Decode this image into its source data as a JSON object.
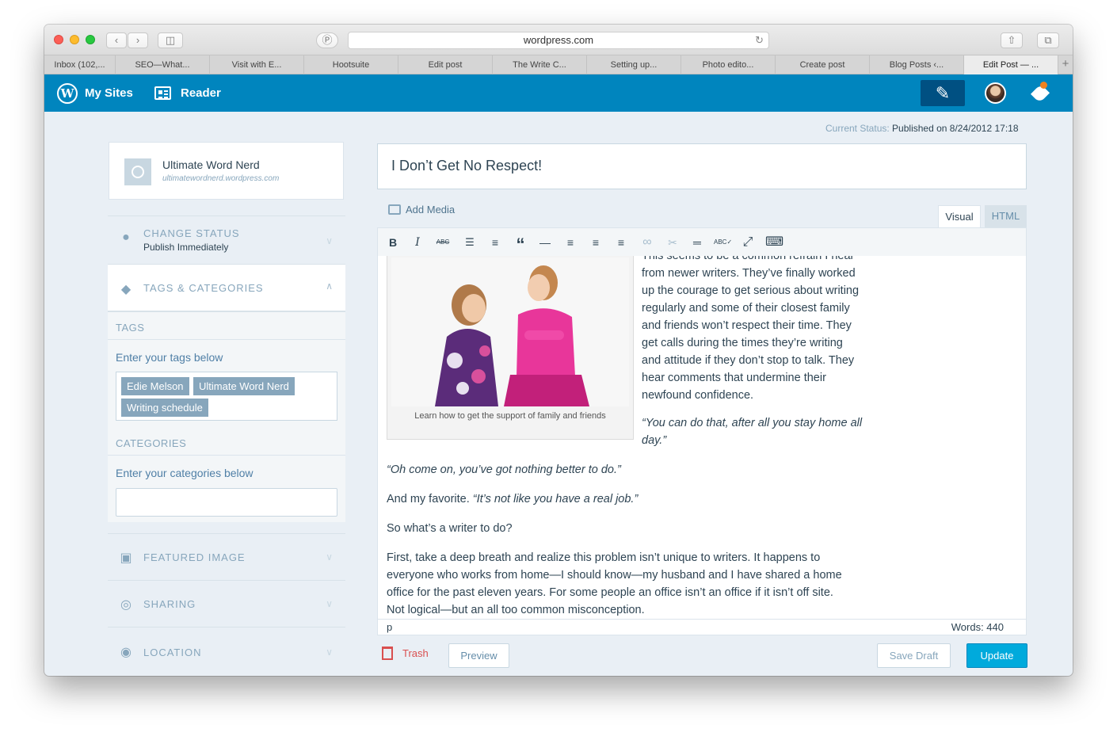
{
  "browser": {
    "url": "wordpress.com",
    "tabs": [
      "Inbox (102,...",
      "SEO—What...",
      "Visit with E...",
      "Hootsuite",
      "Edit post",
      "The Write C...",
      "Setting up...",
      "Photo edito...",
      "Create post",
      "Blog Posts ‹...",
      "Edit Post — ..."
    ],
    "new_tab": "+"
  },
  "masterbar": {
    "my_sites": "My Sites",
    "reader": "Reader",
    "wp_logo_glyph": "W",
    "write_icon": "✎"
  },
  "status": {
    "label": "Current Status:",
    "value": "Published on 8/24/2012 17:18"
  },
  "site": {
    "name": "Ultimate Word Nerd",
    "url": "ultimatewordnerd.wordpress.com"
  },
  "sidebar": {
    "change_status": {
      "title": "CHANGE STATUS",
      "subtitle": "Publish Immediately",
      "icon": "pin-icon"
    },
    "tags_categories": {
      "title": "TAGS & CATEGORIES",
      "icon": "tag-icon"
    },
    "tags_label": "TAGS",
    "tags_hint": "Enter your tags below",
    "tags": [
      "Edie Melson",
      "Ultimate Word Nerd",
      "Writing schedule"
    ],
    "categories_label": "CATEGORIES",
    "categories_hint": "Enter your categories below",
    "featured_image": "FEATURED IMAGE",
    "sharing": "SHARING",
    "location": "LOCATION"
  },
  "editor": {
    "title": "I Don’t Get No Respect!",
    "add_media": "Add Media",
    "tab_visual": "Visual",
    "tab_html": "HTML",
    "toolbar": {
      "bold": "B",
      "italic": "I",
      "strike": "ABC",
      "bullets": "☰",
      "numbers": "≡",
      "quote": "“",
      "hr": "—",
      "align_left": "≡",
      "align_center": "≡",
      "align_right": "≡",
      "link": "∞",
      "unlink": "✂",
      "more": "═",
      "spell": "ABC✓",
      "fullscreen": "⤢",
      "kitchen": "⌨"
    },
    "caption": "Learn how to get the support of family and friends",
    "lines_right": [
      "This seems to be a common refrain I hear",
      "from newer writers. They’ve finally worked",
      "up the courage to get serious about writing",
      "regularly and some of their closest family",
      "and friends won’t respect their time. They",
      "get calls during the times they’re writing",
      "and attitude if they don’t stop to talk. They",
      "hear comments that undermine their",
      "newfound confidence."
    ],
    "quote1_line1": "“You can do that, after all you stay home all",
    "quote1_line2": "day.”",
    "quote2": "“Oh come on, you’ve got nothing better to do.”",
    "favorite_prefix": "And my favorite.",
    "favorite_quote": "“It’s not like you have a real job.”",
    "question": "So what’s a writer to do?",
    "para_lines": [
      "First, take a deep breath and realize this problem isn’t unique to writers. It happens to",
      "everyone who works from home—I should know—my husband and I have shared a home",
      "office for the past eleven years. For some people an office isn’t an office if it isn’t off site.",
      "Not logical—but an all too common misconception."
    ],
    "path": "p",
    "word_count": "Words: 440"
  },
  "actions": {
    "trash": "Trash",
    "preview": "Preview",
    "save_draft": "Save Draft",
    "update": "Update"
  },
  "colors": {
    "masterbar": "#0085be",
    "update": "#00aadc",
    "trash": "#d94f4f",
    "tag_chip": "#87a6bc"
  }
}
